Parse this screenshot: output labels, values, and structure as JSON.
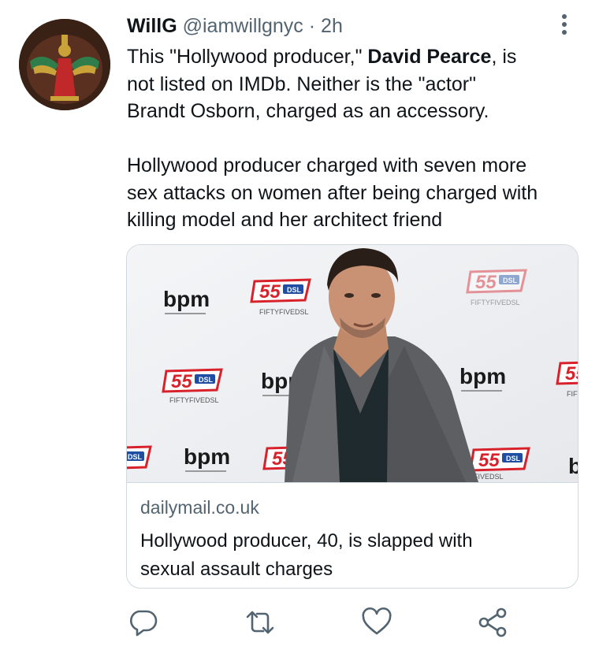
{
  "tweet": {
    "author_name": "WillG",
    "handle": "@iamwillgnyc",
    "separator": "·",
    "time": "2h",
    "text_line1_a": "This \"Hollywood producer,\" ",
    "text_line1_bold": "David Pearce",
    "text_line1_b": ", is",
    "text_line2": "not listed on IMDb. Neither is the \"actor\"",
    "text_line3": "Brandt Osborn, charged as an accessory.",
    "text_line4": "Hollywood producer charged with seven more",
    "text_line5": "sex attacks on women after being charged with",
    "text_line6": "killing model and her architect friend"
  },
  "card": {
    "domain": "dailymail.co.uk",
    "title_line1": "Hollywood producer, 40, is slapped with",
    "title_line2": "sexual assault charges",
    "backdrop_logos": {
      "bpm": "bpm",
      "fiftyfive": "55",
      "fiftyfive_sub": "FIFTYFIVEDSL",
      "dsl": "DSL"
    }
  },
  "actions": {
    "reply_icon": "reply-icon",
    "retweet_icon": "retweet-icon",
    "like_icon": "heart-icon",
    "share_icon": "share-icon"
  },
  "colors": {
    "text": "#0f1419",
    "secondary": "#536471",
    "border": "#cfd9de",
    "logo_red": "#d8222b",
    "logo_blue": "#1f4ea3"
  }
}
